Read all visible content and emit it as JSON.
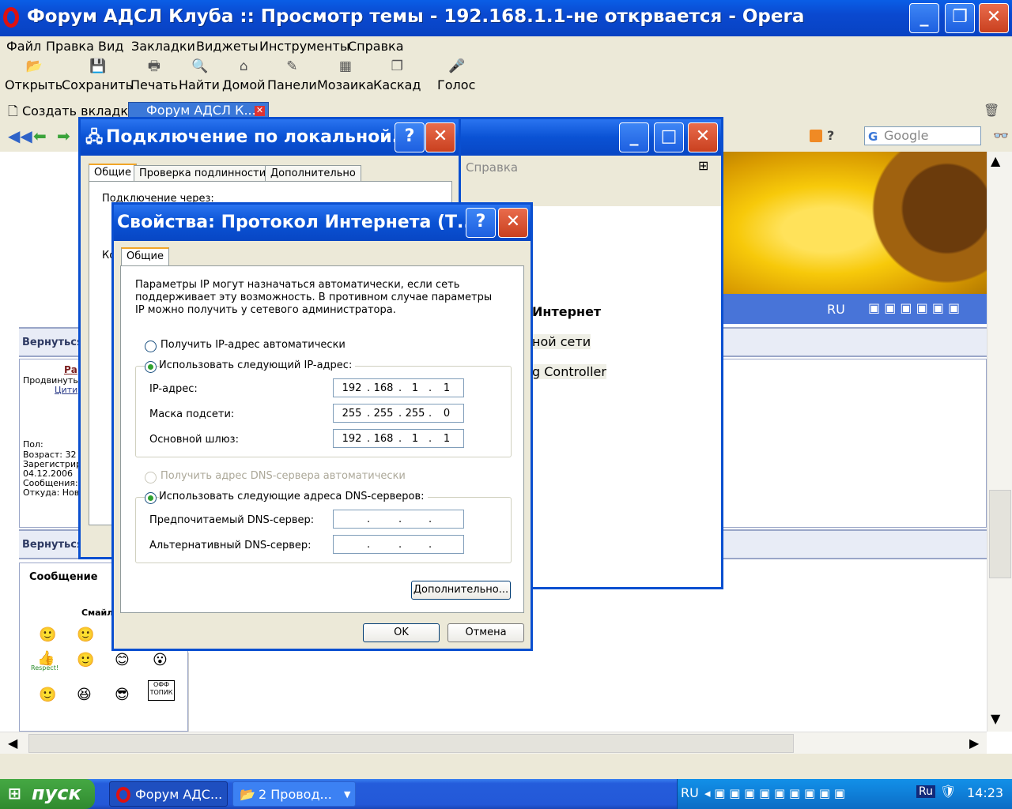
{
  "browser": {
    "title": "Форум АДСЛ Клуба :: Просмотр темы - 192.168.1.1-не открвается - Opera",
    "menu": [
      "Файл",
      "Правка",
      "Вид",
      "Закладки",
      "Виджеты",
      "Инструменты",
      "Справка"
    ],
    "toolbar": [
      "Открыть",
      "Сохранить",
      "Печать",
      "Найти",
      "Домой",
      "Панели",
      "Мозаика",
      "Каскад",
      "Голос"
    ],
    "tabs": {
      "new_tab": "Создать вкладку",
      "active_tab": "Форум АДСЛ К..."
    },
    "search_placeholder": "Google",
    "lang": "RU"
  },
  "page": {
    "back_link_1": "Вернуться",
    "back_link_2": "Вернуться",
    "user_name": "Ра",
    "user_rank": "Продвинуты",
    "user_quote": "Цити",
    "profile": [
      "Пол:",
      "Возраст: 32",
      "Зарегистрир",
      "04.12.2006",
      "Сообщения:",
      "Откуда: Нов"
    ],
    "message_label": "Сообщение",
    "smiles_label": "Смайл",
    "respect": "Respect!",
    "offtopic": "ОФФ ТОПИК"
  },
  "lan_dialog": {
    "title": "Подключение по локальной...",
    "tabs": [
      "Общие",
      "Проверка подлинности",
      "Дополнительно"
    ],
    "connect_via": "Подключение через:",
    "partial_label": "Ко"
  },
  "network_window": {
    "help_menu": "Справка",
    "internet": "Интернет",
    "local_net": "ной сети",
    "controller": "g Controller"
  },
  "tcp_dialog": {
    "title": "Свойства: Протокол Интернета (Т...",
    "tab": "Общие",
    "description": "Параметры IP могут назначаться автоматически, если сеть поддерживает эту возможность. В противном случае параметры IP можно получить у сетевого администратора.",
    "ip_auto": "Получить IP-адрес автоматически",
    "ip_manual": "Использовать следующий IP-адрес:",
    "ip_label": "IP-адрес:",
    "mask_label": "Маска подсети:",
    "gateway_label": "Основной шлюз:",
    "ip": [
      "192",
      "168",
      "1",
      "1"
    ],
    "mask": [
      "255",
      "255",
      "255",
      "0"
    ],
    "gateway": [
      "192",
      "168",
      "1",
      "1"
    ],
    "dns_auto": "Получить адрес DNS-сервера автоматически",
    "dns_manual": "Использовать следующие адреса DNS-серверов:",
    "dns_pref": "Предпочитаемый DNS-сервер:",
    "dns_alt": "Альтернативный DNS-сервер:",
    "advanced": "Дополнительно...",
    "ok": "OK",
    "cancel": "Отмена"
  },
  "taskbar": {
    "start": "пуск",
    "task1": "Форум АДС...",
    "task2": "2 Провод...",
    "lang": "RU",
    "lang2": "Ru",
    "clock": "14:23"
  }
}
